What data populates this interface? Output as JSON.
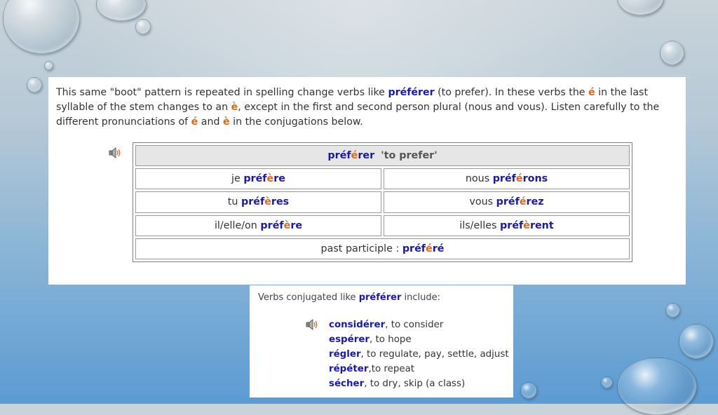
{
  "intro": {
    "p1": "This same \"boot\" pattern is repeated in spelling change verbs like ",
    "verb": "préférer",
    "p2": " (to prefer). In these verbs the ",
    "e_acute": "é",
    "p3": " in the last syllable of the stem changes to an ",
    "e_grave": "è",
    "p4": ", except in the first and second person plural (nous and vous). Listen carefully to the different pronunciations of ",
    "e_acute2": "é",
    "p5": " and ",
    "e_grave2": "è",
    "p6": " in the conjugations below."
  },
  "table": {
    "header_a": "préf",
    "header_b": "é",
    "header_c": "rer",
    "header_gloss": "'to prefer'",
    "rows": [
      {
        "l_pron": "je ",
        "l_a": "préf",
        "l_b": "è",
        "l_c": "re",
        "r_pron": "nous ",
        "r_a": "préf",
        "r_b": "é",
        "r_c": "rons"
      },
      {
        "l_pron": "tu ",
        "l_a": "préf",
        "l_b": "è",
        "l_c": "res",
        "r_pron": "vous ",
        "r_a": "préf",
        "r_b": "é",
        "r_c": "rez"
      },
      {
        "l_pron": "il/elle/on ",
        "l_a": "préf",
        "l_b": "è",
        "l_c": "re",
        "r_pron": "ils/elles ",
        "r_a": "préf",
        "r_b": "è",
        "r_c": "rent"
      }
    ],
    "participle_label": "past participle : ",
    "participle_a": "préf",
    "participle_b": "é",
    "participle_c": "ré"
  },
  "list": {
    "title_pre": "Verbs conjugated like ",
    "title_verb": "préférer",
    "title_post": " include:",
    "items": [
      {
        "verb": "considérer",
        "meaning": ", to consider"
      },
      {
        "verb": "espérer",
        "meaning": ", to hope"
      },
      {
        "verb": "régler",
        "meaning": ", to regulate, pay, settle, adjust"
      },
      {
        "verb": "répéter",
        "meaning": ",to repeat"
      },
      {
        "verb": "sécher",
        "meaning": ", to dry, skip (a class)"
      }
    ]
  },
  "icons": {
    "audio": "speaker-icon"
  },
  "colors": {
    "verb_blue": "#1a1aa6",
    "accent_orange": "#e0661a"
  }
}
